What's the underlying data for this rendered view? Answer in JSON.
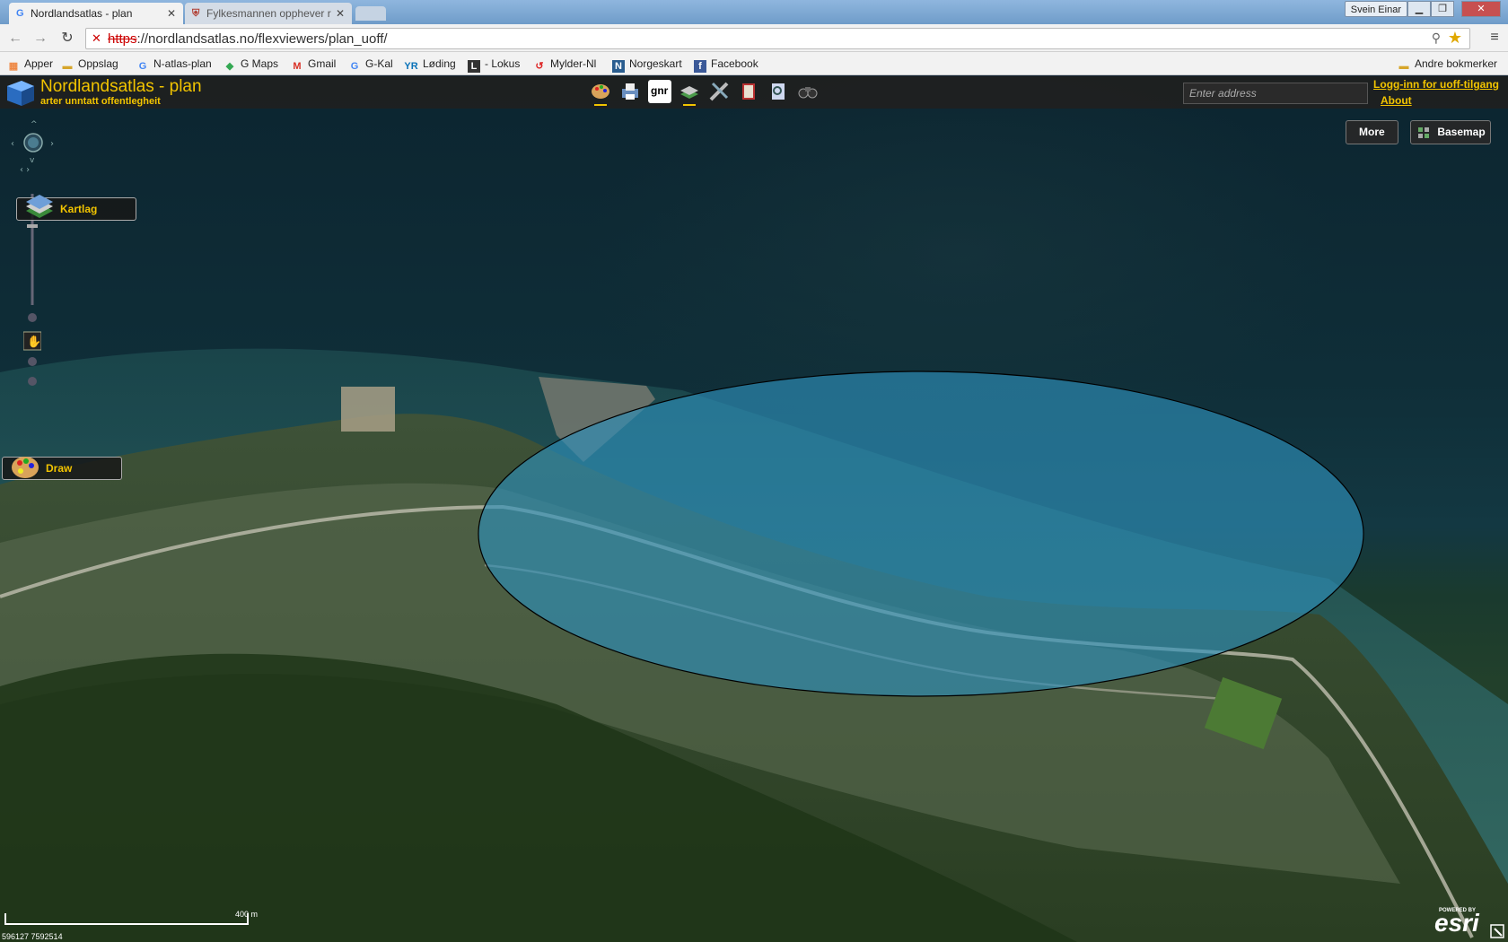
{
  "browser": {
    "tabs": [
      {
        "title": "Nordlandsatlas - plan",
        "active": true,
        "favicon": "G"
      },
      {
        "title": "Fylkesmannen opphever r",
        "active": false,
        "favicon": "shield"
      }
    ],
    "user": "Svein Einar",
    "window_buttons": {
      "minimize": "▁",
      "maximize": "❐",
      "close": "✕"
    },
    "url_scheme": "https",
    "url_rest": "://nordlandsatlas.no/flexviewers/plan_uoff/",
    "bookmarks": [
      {
        "label": "Apper",
        "icon": "apps-grid-icon"
      },
      {
        "label": "Oppslag",
        "icon": "folder-icon"
      },
      {
        "label": "N-atlas-plan",
        "icon": "google-g-icon"
      },
      {
        "label": "G Maps",
        "icon": "maps-icon"
      },
      {
        "label": "Gmail",
        "icon": "gmail-icon"
      },
      {
        "label": "G-Kal",
        "icon": "google-g-icon"
      },
      {
        "label": "Løding",
        "icon": "yr-icon"
      },
      {
        "label": "- Lokus",
        "icon": "lokus-icon"
      },
      {
        "label": "Mylder-Nl",
        "icon": "mylder-icon"
      },
      {
        "label": "Norgeskart",
        "icon": "norgeskart-icon"
      },
      {
        "label": "Facebook",
        "icon": "facebook-icon"
      }
    ],
    "other_bookmarks": "Andre bokmerker"
  },
  "app": {
    "title": "Nordlandsatlas - plan",
    "subtitle": "arter unntatt offentlegheit",
    "address_placeholder": "Enter address",
    "login_link": "Logg-inn for uoff-tilgang",
    "about_link": "About",
    "toolbar_icons": [
      "palette-icon",
      "print-icon",
      "gnr-icon",
      "layers-icon",
      "measure-icon",
      "book-icon",
      "search-doc-icon",
      "binoculars-icon"
    ],
    "gnr_label": "gnr"
  },
  "map": {
    "widgets": {
      "kartlag": "Kartlag",
      "draw": "Draw"
    },
    "more_button": "More",
    "basemap_button": "Basemap",
    "scale_label": "400 m",
    "coordinates": "596127 7592514",
    "attribution": "esri",
    "powered_by": "POWERED BY",
    "overlay_fill": "#2e8fb8"
  }
}
